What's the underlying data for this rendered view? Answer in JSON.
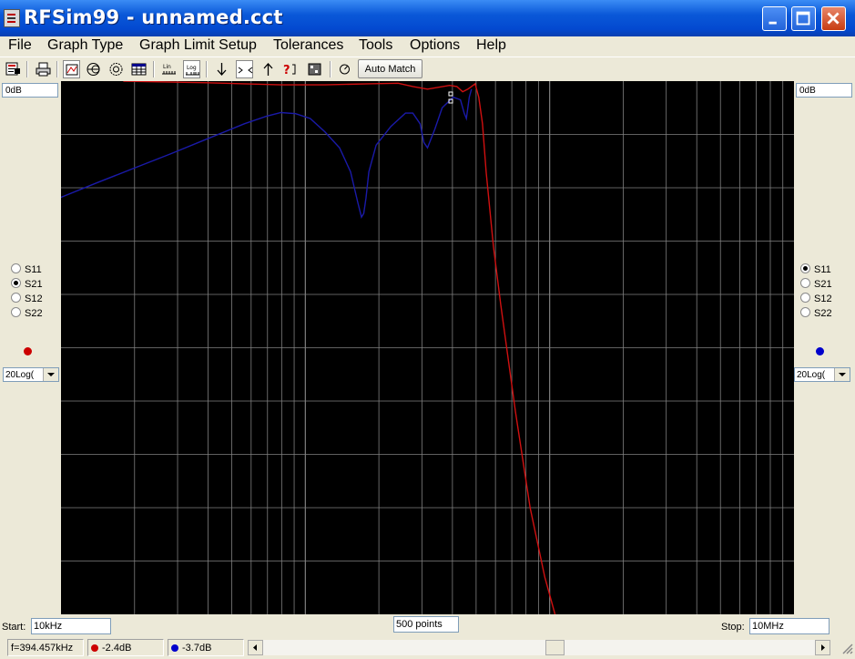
{
  "window": {
    "title": "RFSim99 - unnamed.cct"
  },
  "menu": [
    "File",
    "Graph Type",
    "Graph Limit Setup",
    "Tolerances",
    "Tools",
    "Options",
    "Help"
  ],
  "toolbar": {
    "auto_match_label": "Auto Match",
    "icons": [
      "save-icon",
      "print-icon",
      "rect-graph-icon",
      "smith-chart-icon",
      "polar-icon",
      "table-icon",
      "lin-icon",
      "log-icon",
      "arrow-down-icon",
      "zoom-icon",
      "arrow-up-icon",
      "help-icon",
      "chip-icon",
      "tune-icon"
    ]
  },
  "left_panel": {
    "db_label": "0dB",
    "params": [
      "S11",
      "S21",
      "S12",
      "S22"
    ],
    "selected": "S21",
    "trace_color": "#cc0000",
    "scale_value": "20Log("
  },
  "right_panel": {
    "db_label": "0dB",
    "params": [
      "S11",
      "S21",
      "S12",
      "S22"
    ],
    "selected": "S11",
    "trace_color": "#0000cc",
    "scale_value": "20Log("
  },
  "sweep": {
    "start_label": "Start:",
    "start_value": "10kHz",
    "points_value": "500 points",
    "stop_label": "Stop:",
    "stop_value": "10MHz"
  },
  "status": {
    "frequency": "f=394.457kHz",
    "red_value": "-2.4dB",
    "blue_value": "-3.7dB"
  },
  "chart_data": {
    "type": "line",
    "x_scale": "log",
    "xlim": [
      "10kHz",
      "10MHz"
    ],
    "ytop": "0dB",
    "grid": true,
    "grid_color": "#808080",
    "background": "#000000",
    "series": [
      {
        "color": "#d01010",
        "x_fraction": [
          0.085,
          0.2,
          0.3,
          0.36,
          0.42,
          0.46,
          0.48,
          0.5,
          0.53,
          0.54,
          0.548,
          0.555,
          0.56,
          0.565,
          0.57,
          0.575,
          0.58,
          0.59,
          0.6,
          0.62,
          0.64,
          0.66,
          0.68,
          0.7
        ],
        "y_fraction": [
          0.0,
          0.003,
          0.007,
          0.007,
          0.005,
          0.004,
          0.01,
          0.015,
          0.008,
          0.01,
          0.02,
          0.015,
          0.01,
          0.005,
          0.03,
          0.08,
          0.17,
          0.31,
          0.42,
          0.62,
          0.8,
          0.93,
          1.03,
          1.1
        ]
      },
      {
        "color": "#1a1aa8",
        "x_fraction": [
          0.0,
          0.05,
          0.1,
          0.15,
          0.2,
          0.25,
          0.28,
          0.3,
          0.32,
          0.34,
          0.36,
          0.38,
          0.395,
          0.405,
          0.41,
          0.413,
          0.416,
          0.42,
          0.43,
          0.45,
          0.47,
          0.48,
          0.49,
          0.495,
          0.5,
          0.51,
          0.52,
          0.535,
          0.545,
          0.55,
          0.553,
          0.557,
          0.56
        ],
        "y_fraction": [
          0.218,
          0.19,
          0.163,
          0.136,
          0.108,
          0.08,
          0.066,
          0.059,
          0.061,
          0.07,
          0.095,
          0.125,
          0.17,
          0.228,
          0.255,
          0.248,
          0.22,
          0.17,
          0.12,
          0.085,
          0.06,
          0.06,
          0.08,
          0.115,
          0.125,
          0.09,
          0.05,
          0.03,
          0.035,
          0.06,
          0.07,
          0.03,
          0.015
        ]
      }
    ]
  }
}
